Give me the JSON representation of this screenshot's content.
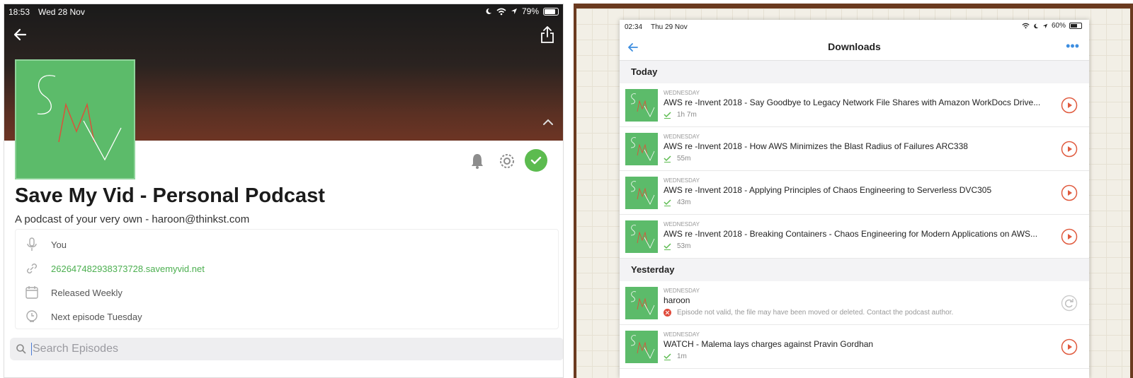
{
  "left": {
    "status": {
      "time": "18:53",
      "date": "Wed 28 Nov",
      "battery": "79%"
    },
    "podcast": {
      "artwork_letters": [
        "S",
        "M",
        "V"
      ],
      "title": "Save My Vid - Personal Podcast",
      "subtitle": "A podcast of your very own - haroon@thinkst.com"
    },
    "info": [
      {
        "icon": "microphone-icon",
        "text": "You"
      },
      {
        "icon": "link-icon",
        "text": "262647482938373728.savemyvid.net"
      },
      {
        "icon": "calendar-icon",
        "text": "Released Weekly"
      },
      {
        "icon": "clock-icon",
        "text": "Next episode Tuesday"
      }
    ],
    "search": {
      "placeholder": "Search Episodes"
    },
    "colors": {
      "accent": "#5cbb4f",
      "link": "#4caf50",
      "art": "#5cbb6a"
    }
  },
  "right": {
    "status": {
      "time": "02:34",
      "date": "Thu 29 Nov",
      "battery": "60%"
    },
    "nav": {
      "title": "Downloads",
      "more": "•••"
    },
    "sections": [
      {
        "label": "Today",
        "items": [
          {
            "day": "WEDNESDAY",
            "title": "AWS re -Invent 2018 - Say Goodbye to Legacy Network File Shares with Amazon WorkDocs Drive...",
            "meta": "1h 7m",
            "state": "play"
          },
          {
            "day": "WEDNESDAY",
            "title": "AWS re -Invent 2018 - How AWS Minimizes the Blast Radius of Failures ARC338",
            "meta": "55m",
            "state": "play"
          },
          {
            "day": "WEDNESDAY",
            "title": "AWS re -Invent 2018 - Applying Principles of Chaos Engineering to Serverless DVC305",
            "meta": "43m",
            "state": "play"
          },
          {
            "day": "WEDNESDAY",
            "title": "AWS re -Invent 2018 - Breaking Containers - Chaos Engineering for Modern Applications on AWS...",
            "meta": "53m",
            "state": "play"
          }
        ]
      },
      {
        "label": "Yesterday",
        "items": [
          {
            "day": "WEDNESDAY",
            "title": "haroon",
            "meta": "Episode not valid, the file may have been moved or deleted. Contact the podcast author.",
            "state": "error"
          },
          {
            "day": "WEDNESDAY",
            "title": "WATCH - Malema lays charges against Pravin Gordhan",
            "meta": "1m",
            "state": "play"
          }
        ]
      }
    ],
    "colors": {
      "accent": "#3c8de0",
      "play": "#e05a3e",
      "error": "#e04a3a"
    }
  }
}
